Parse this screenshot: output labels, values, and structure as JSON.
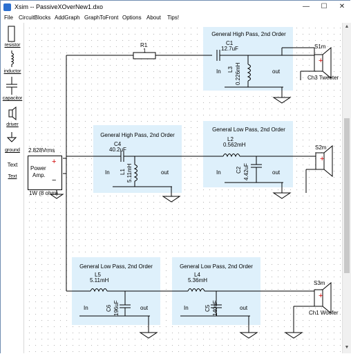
{
  "window": {
    "title": "Xsim -- PassiveXOverNew1.dxo",
    "min": "—",
    "max": "☐",
    "close": "✕"
  },
  "menu": [
    "File",
    "CircuitBlocks",
    "AddGraph",
    "GraphToFront",
    "Options",
    "About",
    "Tips!"
  ],
  "toolbox": {
    "resistor": "resistor",
    "inductor": "inductor",
    "capacitor": "capacitor",
    "driver": "driver",
    "ground": "ground",
    "text1": "Text",
    "text2": "Text"
  },
  "source": {
    "voltage": "2.828Vrms",
    "label1": "Power",
    "label2": "Amp.",
    "plus": "+",
    "minus": "−",
    "load": "1W (8 ohm)"
  },
  "resistor": {
    "name": "R1",
    "value": "1"
  },
  "blocks": {
    "hp1": {
      "title": "General High Pass, 2nd Order",
      "cap_name": "C1",
      "cap_value": "12.7uF",
      "ind_name": "L3",
      "ind_value": "0.226mH",
      "in": "In",
      "out": "out"
    },
    "hp2": {
      "title": "General High Pass, 2nd Order",
      "cap_name": "C4",
      "cap_value": "40.2uF",
      "ind_name": "L1",
      "ind_value": "5.11mH",
      "in": "In",
      "out": "out"
    },
    "lp1": {
      "title": "General Low Pass, 2nd Order",
      "ind_name": "L2",
      "ind_value": "0.562mH",
      "cap_name": "C2",
      "cap_value": "4.42uF",
      "in": "In",
      "out": "out"
    },
    "lp2": {
      "title": "General Low Pass, 2nd Order",
      "ind_name": "L5",
      "ind_value": "5.11mH",
      "cap_name": "C6",
      "cap_value": "196uF",
      "in": "In",
      "out": "out"
    },
    "lp3": {
      "title": "General Low Pass, 2nd Order",
      "ind_name": "L4",
      "ind_value": "5.36mH",
      "cap_name": "C5",
      "cap_value": "140uF",
      "in": "In",
      "out": "out"
    }
  },
  "speakers": {
    "s1": {
      "name": "S1m",
      "label": "Ch3 Tweeter",
      "plus": "+"
    },
    "s2": {
      "name": "S2m",
      "label": "",
      "plus": "+"
    },
    "s3": {
      "name": "S3m",
      "label": "Ch1 Woofer",
      "plus": "+"
    }
  },
  "colors": {
    "block_fill": "#def0fb",
    "plus_red": "#d00000",
    "title_bar": "#ffffff"
  }
}
